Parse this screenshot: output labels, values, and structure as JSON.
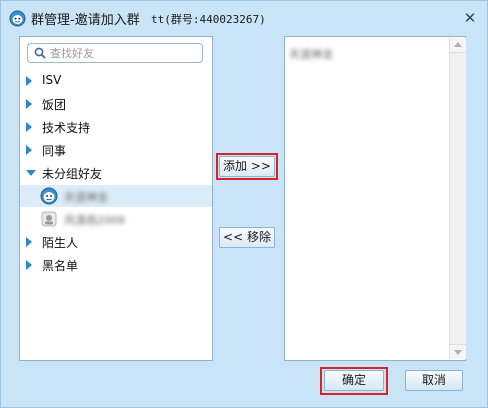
{
  "window": {
    "title": "群管理-邀请加入群",
    "subtitle": "tt(群号:440023267)",
    "close_glyph": "✕",
    "colors": {
      "chrome": "#c9e4f6",
      "border": "#8fb3cc",
      "highlight": "#d8232a",
      "accent": "#2d89c8"
    }
  },
  "search": {
    "placeholder": "查找好友",
    "icon": "search-icon"
  },
  "groups": [
    {
      "label": "ISV",
      "expanded": false
    },
    {
      "label": "饭团",
      "expanded": false
    },
    {
      "label": "技术支持",
      "expanded": false
    },
    {
      "label": "同事",
      "expanded": false
    },
    {
      "label": "未分组好友",
      "expanded": true
    },
    {
      "label": "陌生人",
      "expanded": false
    },
    {
      "label": "黑名单",
      "expanded": false
    }
  ],
  "friends": [
    {
      "name": "天涯神龙",
      "icon": "avatar-online-icon",
      "selected": true
    },
    {
      "name": "风清扬2009",
      "icon": "avatar-offline-icon",
      "selected": false
    }
  ],
  "buttons": {
    "add": "添加 >>",
    "remove": "<< 移除",
    "ok": "确定",
    "cancel": "取消"
  },
  "added_members": [
    "天涯神龙"
  ]
}
